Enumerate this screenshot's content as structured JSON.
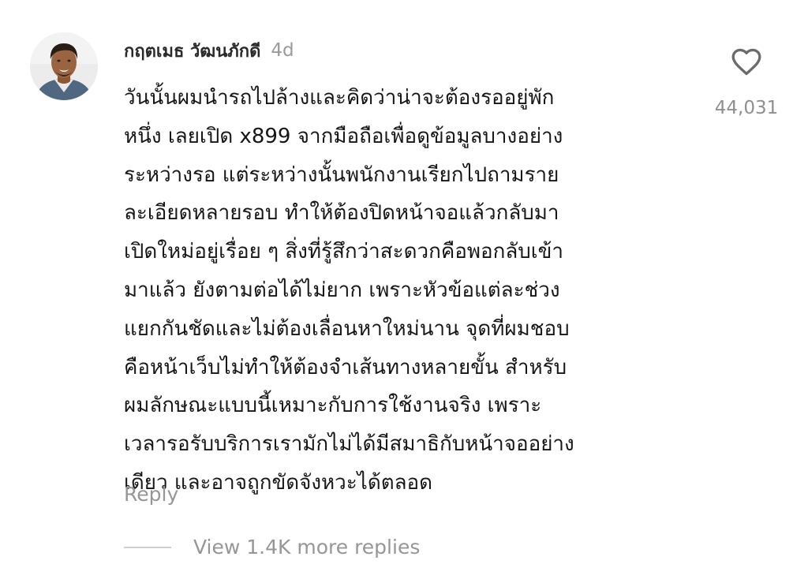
{
  "comment": {
    "author": "กฤตเมธ วัฒนภักดี",
    "time_ago": "4d",
    "body_lines": [
      "วันนั้นผมนำรถไปล้างและคิดว่าน่าจะต้องรออยู่พัก",
      "หนึ่ง เลยเปิด x899 จากมือถือเพื่อดูข้อมูลบางอย่าง",
      "ระหว่างรอ แต่ระหว่างนั้นพนักงานเรียกไปถามราย",
      "ละเอียดหลายรอบ ทำให้ต้องปิดหน้าจอแล้วกลับมา",
      "เปิดใหม่อยู่เรื่อย ๆ สิ่งที่รู้สึกว่าสะดวกคือพอกลับเข้า",
      "มาแล้ว ยังตามต่อได้ไม่ยาก เพราะหัวข้อแต่ละช่วง",
      "แยกกันชัดและไม่ต้องเลื่อนหาใหม่นาน จุดที่ผมชอบ",
      "คือหน้าเว็บไม่ทำให้ต้องจำเส้นทางหลายขั้น สำหรับ",
      "ผมลักษณะแบบนี้เหมาะกับการใช้งานจริง เพราะ",
      "เวลารอรับบริการเรามักไม่ได้มีสมาธิกับหน้าจออย่าง",
      "เดียว และอาจถูกขัดจังหวะได้ตลอด"
    ],
    "reply_label": "Reply",
    "more_replies_label": "View 1.4K more replies",
    "like_count": "44,031",
    "like_icon": "heart-outline-icon"
  }
}
